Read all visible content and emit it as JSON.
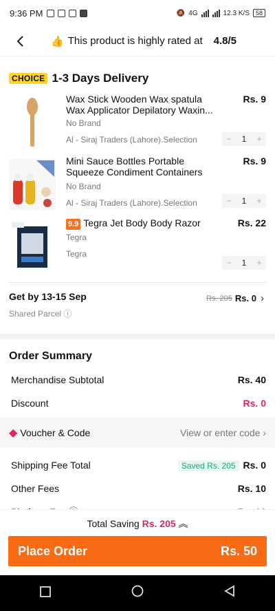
{
  "status": {
    "time": "9:36 PM",
    "network": "4G",
    "speed": "12.3 K/S",
    "battery": "58"
  },
  "header": {
    "back_icon": "back-icon",
    "text": "This product is highly rated at",
    "rating": "4.8/5"
  },
  "delivery": {
    "choice_badge": "CHOICE",
    "title": "1-3 Days Delivery",
    "items": [
      {
        "name": "Wax Stick Wooden Wax spatula Wax Applicator Depilatory Waxin...",
        "brand": "No Brand",
        "seller": "Al - Siraj Traders (Lahore).Selection",
        "price": "Rs. 9",
        "qty": "1",
        "minus": "−",
        "plus": "+"
      },
      {
        "name": "Mini Sauce Bottles Portable Squeeze Condiment Containers fo...",
        "brand": "No Brand",
        "seller": "Al - Siraj Traders (Lahore).Selection",
        "price": "Rs. 9",
        "qty": "1",
        "minus": "−",
        "plus": "+"
      },
      {
        "tag": "9.9",
        "name": "Tegra Jet Body Body Razor",
        "brand": "Tegra",
        "seller": "Tegra",
        "price": "Rs. 22",
        "qty": "1",
        "minus": "−",
        "plus": "+"
      }
    ],
    "getby": "Get by 13-15 Sep",
    "shared": "Shared Parcel",
    "old_fee": "Rs. 205",
    "new_fee": "Rs. 0"
  },
  "summary": {
    "title": "Order Summary",
    "merch_label": "Merchandise Subtotal",
    "merch_value": "Rs. 40",
    "discount_label": "Discount",
    "discount_value": "Rs. 0",
    "voucher_label": "Voucher & Code",
    "voucher_link": "View or enter code",
    "shipping_label": "Shipping Fee Total",
    "saved": "Saved Rs. 205",
    "shipping_value": "Rs. 0",
    "other_label": "Other Fees",
    "other_value": "Rs. 10",
    "platform_label": "Platform Fee",
    "platform_value": "Rs. 10"
  },
  "footer": {
    "saving_label": "Total Saving",
    "saving_value": "Rs. 205",
    "place_label": "Place Order",
    "total": "Rs. 50"
  },
  "colors": {
    "accent": "#f96a15",
    "pink": "#e0245e",
    "choice": "#ffd42a"
  }
}
